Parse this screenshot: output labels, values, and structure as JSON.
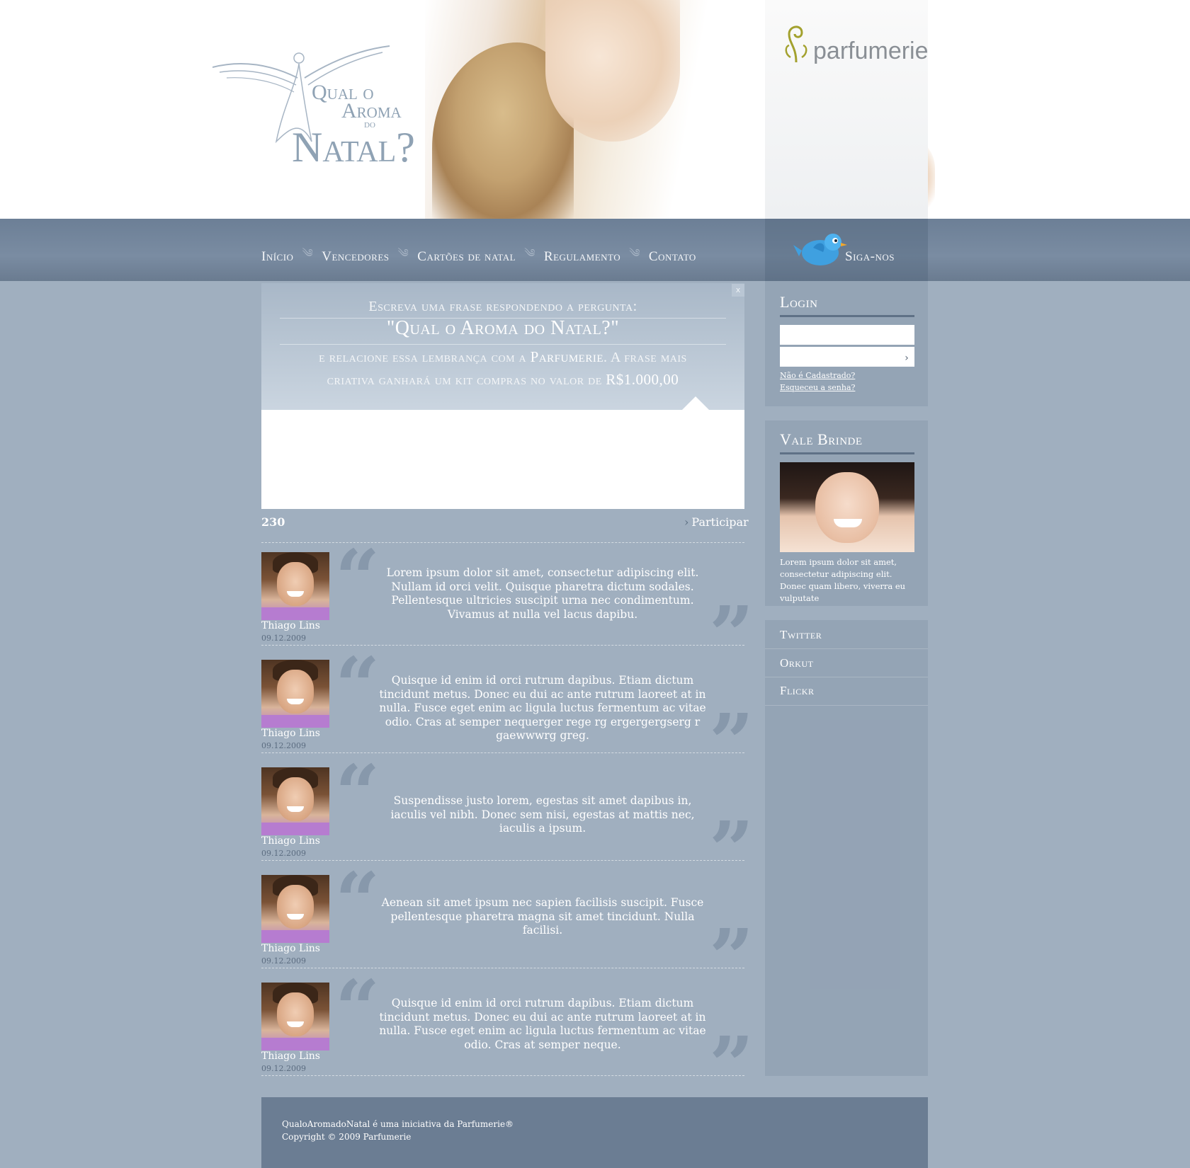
{
  "header": {
    "campaign_title_line1": "Qual o",
    "campaign_title_line2": "Aroma",
    "campaign_title_line3": "do",
    "campaign_title_line4": "Natal?",
    "brand_name": "parfumerie"
  },
  "nav": {
    "items": [
      {
        "label": "Início"
      },
      {
        "label": "Vencedores"
      },
      {
        "label": "Cartões de natal"
      },
      {
        "label": "Regulamento"
      },
      {
        "label": "Contato"
      }
    ],
    "separator_glyph": "༄",
    "follow_label": "Siga-nos"
  },
  "prompt": {
    "close_label": "x",
    "line1": "Escreva uma frase respondendo a pergunta:",
    "question": "\"Qual o Aroma do Natal?\"",
    "line3_pre": "e relacione essa lembrança com a ",
    "line3_brand": "Parfumerie",
    "line3_post": ". A frase mais",
    "line4_pre": "criativa ganhará um kit compras no valor de ",
    "line4_value": "R$1.000,00",
    "input_value": ""
  },
  "counter": "230",
  "participate_label": "Participar",
  "entries": [
    {
      "author": "Thiago Lins",
      "date": "09.12.2009",
      "text": "Lorem ipsum dolor sit amet, consectetur adipiscing elit. Nullam id orci velit. Quisque pharetra dictum sodales. Pellentesque ultricies suscipit urna nec condimentum. Vivamus at nulla vel lacus dapibu."
    },
    {
      "author": "Thiago Lins",
      "date": "09.12.2009",
      "text": "Quisque id enim id orci rutrum dapibus. Etiam dictum tincidunt metus. Donec eu dui ac ante rutrum laoreet at in nulla. Fusce eget enim ac ligula luctus fermentum ac vitae odio. Cras at semper nequerger rege rg ergergergserg r gaewwwrg greg."
    },
    {
      "author": "Thiago Lins",
      "date": "09.12.2009",
      "text": "Suspendisse justo lorem, egestas sit amet dapibus in, iaculis vel nibh. Donec sem nisi, egestas at mattis nec, iaculis a ipsum."
    },
    {
      "author": "Thiago Lins",
      "date": "09.12.2009",
      "text": "Aenean sit amet ipsum nec sapien facilisis suscipit. Fusce pellentesque pharetra magna sit amet tincidunt. Nulla facilisi."
    },
    {
      "author": "Thiago Lins",
      "date": "09.12.2009",
      "text": "Quisque id enim id orci rutrum dapibus. Etiam dictum tincidunt metus. Donec eu dui ac ante rutrum laoreet at in nulla. Fusce eget enim ac ligula luctus fermentum ac vitae odio. Cras at semper neque."
    }
  ],
  "sidebar": {
    "login": {
      "title": "Login",
      "username_value": "",
      "password_value": "",
      "submit_glyph": "›",
      "register_link": "Não é Cadastrado?",
      "forgot_link": "Esqueceu a senha?"
    },
    "gift": {
      "title": "Vale Brinde",
      "text": "Lorem ipsum dolor sit amet, consectetur adipiscing elit. Donec quam libero, viverra eu vulputate"
    },
    "social": [
      {
        "label": "Twitter"
      },
      {
        "label": "Orkut"
      },
      {
        "label": "Flickr"
      }
    ]
  },
  "footer": {
    "line1": "QualoAromadoNatal é uma iniciativa da Parfumerie®",
    "line2": "Copyright © 2009 Parfumerie"
  },
  "colors": {
    "page_background": "#a0afbf",
    "nav_background": "#7a8ca2",
    "footer_background": "#6b7d93",
    "accent_text": "#ffffff",
    "brand_olive": "#a3a12e"
  },
  "icons": {
    "close": "close-icon",
    "arrow": "chevron-right-icon",
    "bird": "twitter-bird-icon",
    "quote_open": "quote-open-icon",
    "quote_close": "quote-close-icon"
  }
}
